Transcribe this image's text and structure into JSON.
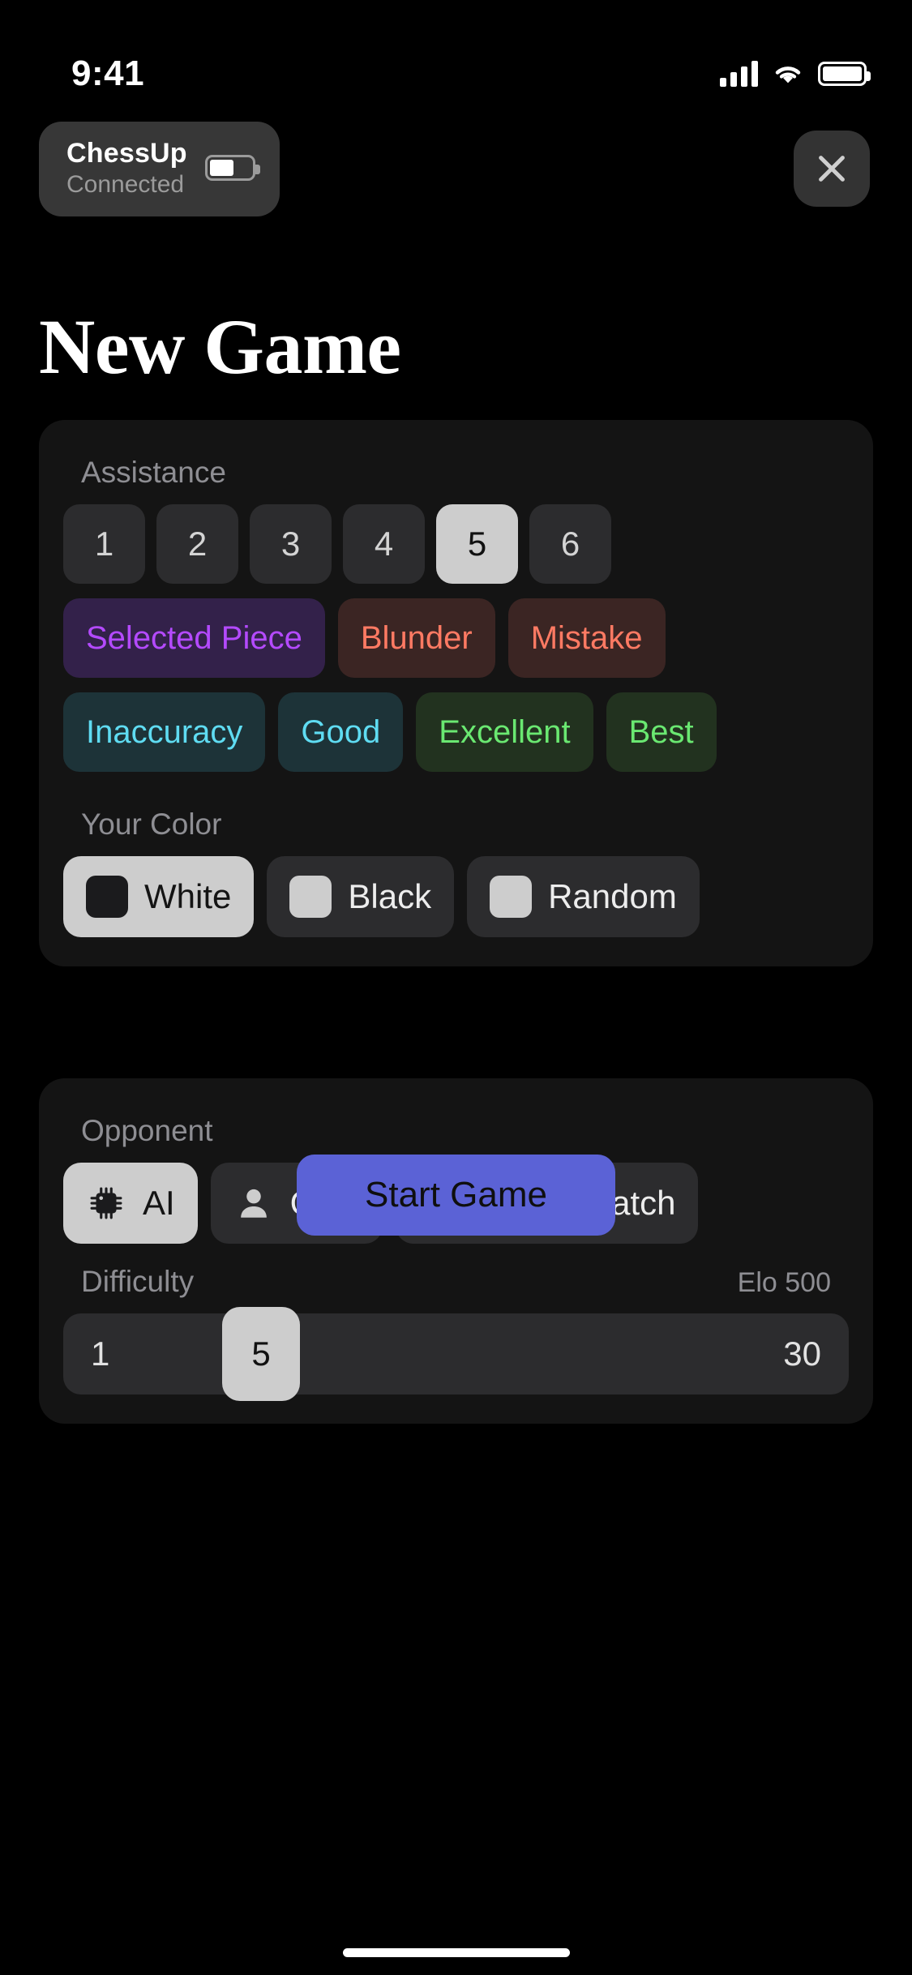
{
  "status_bar": {
    "time": "9:41",
    "cellular_icon": "signal-bars-icon",
    "wifi_icon": "wifi-icon",
    "battery_icon": "battery-icon"
  },
  "top_bar": {
    "device": {
      "name": "ChessUp",
      "status": "Connected",
      "battery_icon": "device-battery-icon",
      "battery_level_percent": 58
    },
    "close_label": "close-icon"
  },
  "page_title": "New Game",
  "assistance": {
    "label": "Assistance",
    "levels": [
      "1",
      "2",
      "3",
      "4",
      "5",
      "6"
    ],
    "selected_level": "5",
    "chips_row_1": [
      {
        "label": "Selected Piece",
        "text_color": "#b44aff",
        "bg_color": "#33214a"
      },
      {
        "label": "Blunder",
        "text_color": "#ff7a63",
        "bg_color": "#3b2523"
      },
      {
        "label": "Mistake",
        "text_color": "#ff7a63",
        "bg_color": "#3b2523"
      }
    ],
    "chips_row_2": [
      {
        "label": "Inaccuracy",
        "text_color": "#5fdcf2",
        "bg_color": "#1d3338"
      },
      {
        "label": "Good",
        "text_color": "#5fdcf2",
        "bg_color": "#1d3338"
      },
      {
        "label": "Excellent",
        "text_color": "#6ae871",
        "bg_color": "#22321f"
      },
      {
        "label": "Best",
        "text_color": "#6ae871",
        "bg_color": "#22321f"
      }
    ]
  },
  "your_color": {
    "label": "Your Color",
    "options": [
      {
        "label": "White",
        "swatch": "dark",
        "selected": true
      },
      {
        "label": "Black",
        "swatch": "light",
        "selected": false
      },
      {
        "label": "Random",
        "swatch": "light",
        "selected": false
      }
    ]
  },
  "opponent": {
    "label": "Opponent",
    "options": [
      {
        "label": "AI",
        "icon": "cpu-chip-icon",
        "selected": true
      },
      {
        "label": "OTB",
        "icon": "person-icon",
        "selected": false
      },
      {
        "label": "Online Match",
        "icon": "globe-icon",
        "selected": false
      }
    ]
  },
  "difficulty": {
    "label": "Difficulty",
    "elo_label": "Elo 500",
    "min": "1",
    "max": "30",
    "value": "5"
  },
  "start_button": {
    "label": "Start Game",
    "color": "#5b62d6"
  }
}
